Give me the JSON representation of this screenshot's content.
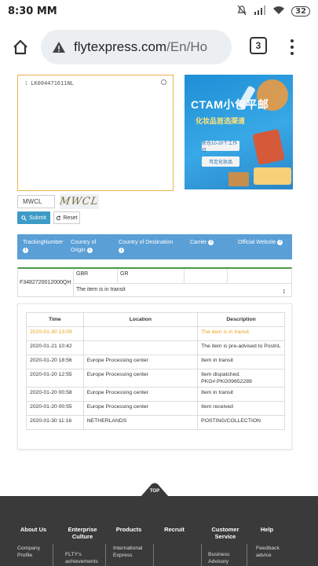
{
  "status_bar": {
    "time": "8:30 MM",
    "battery": "32"
  },
  "browser": {
    "url_main": "flytexpress.com",
    "url_rest": "/En/Ho",
    "tab_count": "3"
  },
  "tracking_form": {
    "line_number": "1",
    "tracking_input_value": "LK004471611NL",
    "captcha_value": "MWCL",
    "captcha_image_text": "MWCL",
    "submit_label": "Submit",
    "reset_label": "Reset"
  },
  "ad_banner": {
    "title": "CTAM小包平邮",
    "subtitle": "化妆品首选渠道",
    "button1": "新仓10-20个工作日",
    "button2": "可走化妆品"
  },
  "result_header": {
    "tracking_number": "TrackingNumber",
    "country_of_origin": "Country of Origin",
    "country_of_destination": "Country of Destination",
    "carrier": "Carrier",
    "official_website": "Official Website"
  },
  "result_row": {
    "number": "F3482720012000QH",
    "origin": "GBR",
    "destination": "GR",
    "status": "The item is in transit"
  },
  "events_table": {
    "headers": [
      "Time",
      "Location",
      "Description"
    ],
    "rows": [
      {
        "time": "2020-01-30 13:09",
        "location": "",
        "description": "The item is in transit"
      },
      {
        "time": "2020-01-21 10:42",
        "location": "",
        "description": "The item is pre-advised to PostnL"
      },
      {
        "time": "2020-01-20 18:56",
        "location": "Europe Processing center",
        "description": "Item in transit"
      },
      {
        "time": "2020-01-20 12:55",
        "location": "Europe Processing center",
        "description": "Item dispatched. PKG#:PKG09652289"
      },
      {
        "time": "2020-01-20 00:58",
        "location": "Europe Processing center",
        "description": "Item in transit"
      },
      {
        "time": "2020-01-20 00:55",
        "location": "Europe Processing center",
        "description": "Item received"
      },
      {
        "time": "2020-01-30 11:16",
        "location": "NETHERLANDS",
        "description": "POSTING/COLLECTION"
      }
    ]
  },
  "top_button": "TOP",
  "footer": {
    "columns": [
      "About Us",
      "Enterprise Culture",
      "Products",
      "Recruit",
      "Customer Service",
      "Help"
    ],
    "links": [
      "Company Profile",
      "FLTY's achievements",
      "International Express",
      "Business Advisory",
      "Feedback advice"
    ]
  },
  "colors": {
    "accent": "#3d9bc6",
    "header_blue": "#5a9fd6",
    "highlight": "#e8a218",
    "footer_bg": "#3a3a3a"
  }
}
